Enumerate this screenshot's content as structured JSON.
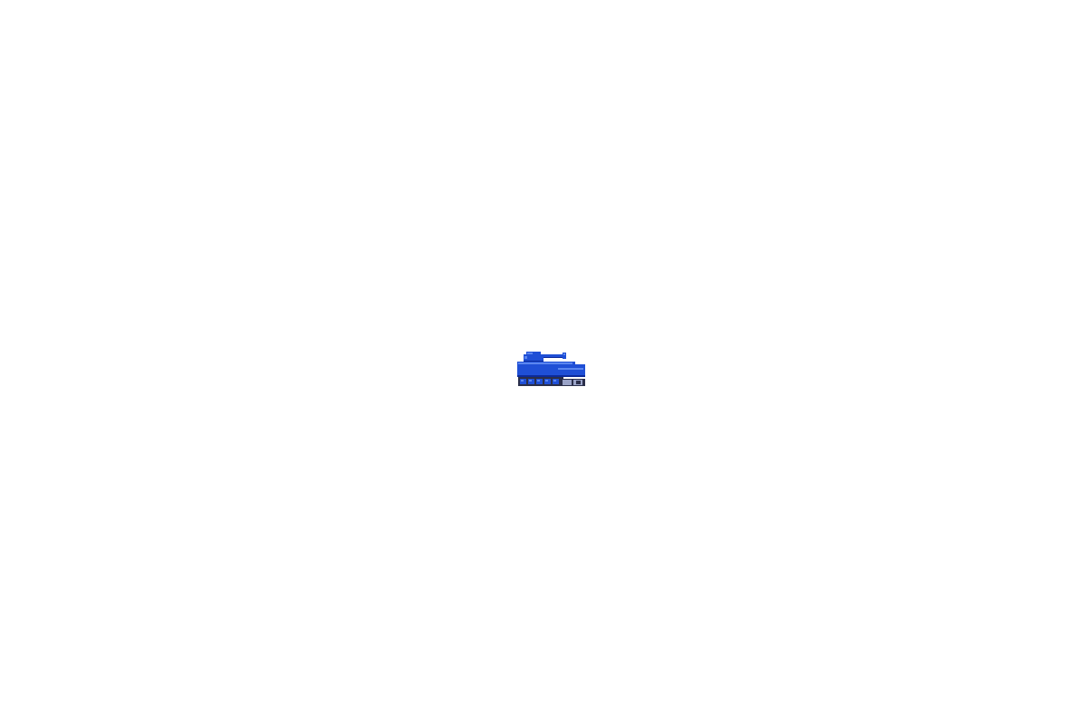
{
  "scene": {
    "background_color": "#ffffff",
    "unit": {
      "icon": "tank-icon",
      "team_color": "#1f4fd6",
      "team_color_dark": "#0c2a9a",
      "team_color_light": "#5b86f0",
      "tread_color": "#2b2f4a",
      "wheel_color": "#9aa3c7"
    }
  }
}
